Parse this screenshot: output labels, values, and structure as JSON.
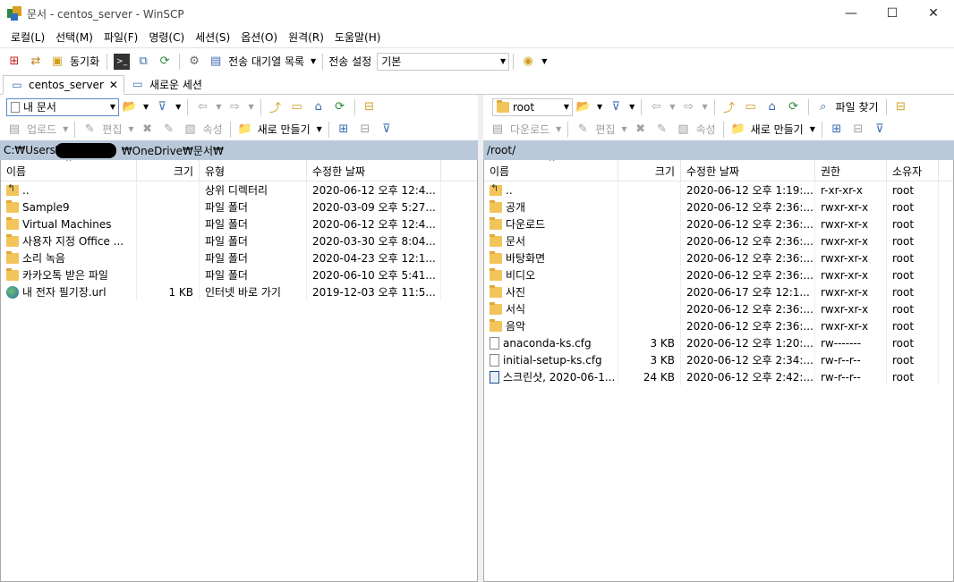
{
  "window": {
    "title": "문서 - centos_server - WinSCP"
  },
  "menu": [
    "로컬(L)",
    "선택(M)",
    "파일(F)",
    "명령(C)",
    "세션(S)",
    "옵션(O)",
    "원격(R)",
    "도움말(H)"
  ],
  "toolbar1": {
    "sync_label": "동기화",
    "queue_label": "전송 대기열 목록",
    "transfer_settings_label": "전송 설정",
    "transfer_preset": "기본"
  },
  "tabs": {
    "session": "centos_server",
    "new_session": "새로운 세션"
  },
  "left": {
    "location": "내 문서",
    "upload": "업로드",
    "edit": "편집",
    "properties": "속성",
    "new": "새로 만들기",
    "path_prefix": "C:₩Users₩",
    "path_suffix": "₩OneDrive₩문서₩",
    "headers": {
      "name": "이름",
      "size": "크기",
      "type": "유형",
      "modified": "수정한 날짜"
    },
    "rows": [
      {
        "icon": "up",
        "name": "..",
        "size": "",
        "type": "상위 디렉터리",
        "modified": "2020-06-12  오후 12:4..."
      },
      {
        "icon": "folder",
        "name": "Sample9",
        "size": "",
        "type": "파일 폴더",
        "modified": "2020-03-09  오후 5:27..."
      },
      {
        "icon": "folder",
        "name": "Virtual Machines",
        "size": "",
        "type": "파일 폴더",
        "modified": "2020-06-12  오후 12:4..."
      },
      {
        "icon": "folder",
        "name": "사용자 지정 Office ...",
        "size": "",
        "type": "파일 폴더",
        "modified": "2020-03-30  오후 8:04..."
      },
      {
        "icon": "folder",
        "name": "소리 녹음",
        "size": "",
        "type": "파일 폴더",
        "modified": "2020-04-23  오후 12:1..."
      },
      {
        "icon": "folder",
        "name": "카카오톡 받은 파일",
        "size": "",
        "type": "파일 폴더",
        "modified": "2020-06-10  오후 5:41..."
      },
      {
        "icon": "globe",
        "name": "내 전자 필기장.url",
        "size": "1 KB",
        "type": "인터넷 바로 가기",
        "modified": "2019-12-03  오후 11:5..."
      }
    ]
  },
  "right": {
    "location": "root",
    "download": "다운로드",
    "edit": "편집",
    "properties": "속성",
    "new": "새로 만들기",
    "find": "파일 찾기",
    "path": "/root/",
    "headers": {
      "name": "이름",
      "size": "크기",
      "modified": "수정한 날짜",
      "rights": "권한",
      "owner": "소유자"
    },
    "rows": [
      {
        "icon": "up",
        "name": "..",
        "size": "",
        "modified": "2020-06-12 오후 1:19:...",
        "rights": "r-xr-xr-x",
        "owner": "root"
      },
      {
        "icon": "folder",
        "name": "공개",
        "size": "",
        "modified": "2020-06-12 오후 2:36:...",
        "rights": "rwxr-xr-x",
        "owner": "root"
      },
      {
        "icon": "folder",
        "name": "다운로드",
        "size": "",
        "modified": "2020-06-12 오후 2:36:...",
        "rights": "rwxr-xr-x",
        "owner": "root"
      },
      {
        "icon": "folder",
        "name": "문서",
        "size": "",
        "modified": "2020-06-12 오후 2:36:...",
        "rights": "rwxr-xr-x",
        "owner": "root"
      },
      {
        "icon": "folder",
        "name": "바탕화면",
        "size": "",
        "modified": "2020-06-12 오후 2:36:...",
        "rights": "rwxr-xr-x",
        "owner": "root"
      },
      {
        "icon": "folder",
        "name": "비디오",
        "size": "",
        "modified": "2020-06-12 오후 2:36:...",
        "rights": "rwxr-xr-x",
        "owner": "root"
      },
      {
        "icon": "folder",
        "name": "사진",
        "size": "",
        "modified": "2020-06-17 오후 12:1...",
        "rights": "rwxr-xr-x",
        "owner": "root"
      },
      {
        "icon": "folder",
        "name": "서식",
        "size": "",
        "modified": "2020-06-12 오후 2:36:...",
        "rights": "rwxr-xr-x",
        "owner": "root"
      },
      {
        "icon": "folder",
        "name": "음악",
        "size": "",
        "modified": "2020-06-12 오후 2:36:...",
        "rights": "rwxr-xr-x",
        "owner": "root"
      },
      {
        "icon": "doc",
        "name": "anaconda-ks.cfg",
        "size": "3 KB",
        "modified": "2020-06-12 오후 1:20:...",
        "rights": "rw-------",
        "owner": "root"
      },
      {
        "icon": "doc",
        "name": "initial-setup-ks.cfg",
        "size": "3 KB",
        "modified": "2020-06-12 오후 2:34:...",
        "rights": "rw-r--r--",
        "owner": "root"
      },
      {
        "icon": "img",
        "name": "스크린샷, 2020-06-1...",
        "size": "24 KB",
        "modified": "2020-06-12 오후 2:42:...",
        "rights": "rw-r--r--",
        "owner": "root"
      }
    ]
  }
}
